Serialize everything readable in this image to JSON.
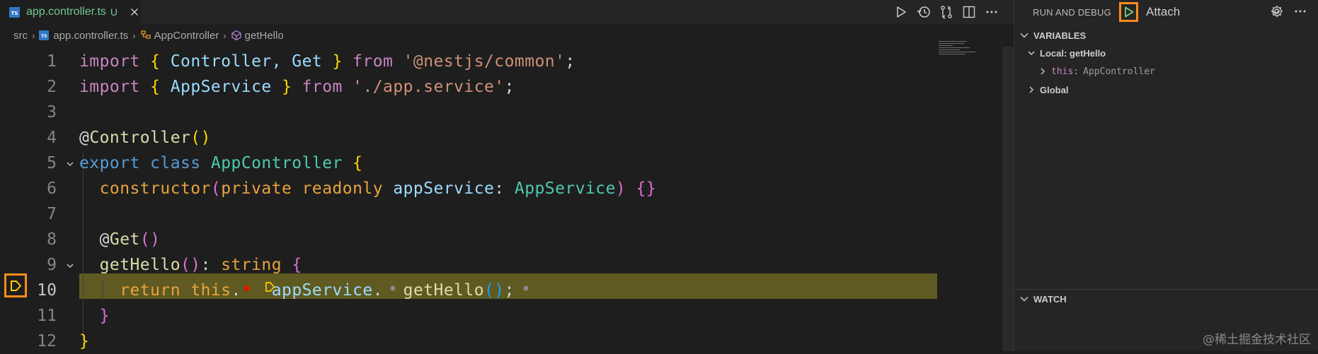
{
  "tab": {
    "icon_text": "TS",
    "filename": "app.controller.ts",
    "status": "U"
  },
  "editor_actions": [
    "run-icon",
    "timeline-icon",
    "compare-changes-icon",
    "split-editor-icon",
    "more-actions-icon"
  ],
  "breadcrumb": {
    "folder": "src",
    "file": "app.controller.ts",
    "class": "AppController",
    "method": "getHello"
  },
  "code": {
    "line_numbers": [
      "1",
      "2",
      "3",
      "4",
      "5",
      "6",
      "7",
      "8",
      "9",
      "10",
      "11",
      "12"
    ],
    "active_line": "10",
    "lines": [
      {
        "n": 1,
        "tokens": [
          [
            "import",
            "ctl"
          ],
          [
            " ",
            ""
          ],
          [
            "{",
            "brY"
          ],
          [
            " Controller, Get ",
            "vr"
          ],
          [
            "}",
            "brY"
          ],
          [
            " ",
            ""
          ],
          [
            "from",
            "ctl"
          ],
          [
            " ",
            ""
          ],
          [
            "'@nestjs/common'",
            "str"
          ],
          [
            ";",
            ""
          ]
        ]
      },
      {
        "n": 2,
        "tokens": [
          [
            "import",
            "ctl"
          ],
          [
            " ",
            ""
          ],
          [
            "{",
            "brY"
          ],
          [
            " AppService ",
            "vr"
          ],
          [
            "}",
            "brY"
          ],
          [
            " ",
            ""
          ],
          [
            "from",
            "ctl"
          ],
          [
            " ",
            ""
          ],
          [
            "'./app.service'",
            "str"
          ],
          [
            ";",
            ""
          ]
        ]
      },
      {
        "n": 3,
        "tokens": []
      },
      {
        "n": 4,
        "tokens": [
          [
            "@",
            ""
          ],
          [
            "Controller",
            "fn"
          ],
          [
            "()",
            "brY"
          ]
        ]
      },
      {
        "n": 5,
        "tokens": [
          [
            "export",
            "kw"
          ],
          [
            " ",
            ""
          ],
          [
            "class",
            "kw"
          ],
          [
            " ",
            ""
          ],
          [
            "AppController",
            "ty"
          ],
          [
            " ",
            ""
          ],
          [
            "{",
            "brY"
          ]
        ]
      },
      {
        "n": 6,
        "tokens": [
          [
            "  ",
            ""
          ],
          [
            "constructor",
            "kwo"
          ],
          [
            "(",
            "brP"
          ],
          [
            "private",
            "kwo"
          ],
          [
            " ",
            ""
          ],
          [
            "readonly",
            "kwo"
          ],
          [
            " ",
            ""
          ],
          [
            "appService",
            "vr"
          ],
          [
            ": ",
            ""
          ],
          [
            "AppService",
            "ty"
          ],
          [
            ")",
            "brP"
          ],
          [
            " ",
            ""
          ],
          [
            "{}",
            "brP"
          ]
        ]
      },
      {
        "n": 7,
        "tokens": []
      },
      {
        "n": 8,
        "tokens": [
          [
            "  @",
            ""
          ],
          [
            "Get",
            "fn"
          ],
          [
            "()",
            "brP"
          ]
        ]
      },
      {
        "n": 9,
        "tokens": [
          [
            "  ",
            ""
          ],
          [
            "getHello",
            "fn"
          ],
          [
            "()",
            "brP"
          ],
          [
            ": ",
            ""
          ],
          [
            "string",
            "kwo"
          ],
          [
            " ",
            ""
          ],
          [
            "{",
            "brP"
          ]
        ]
      },
      {
        "n": 10,
        "tokens": [
          [
            "    ",
            ""
          ],
          [
            "return",
            "kwo"
          ],
          [
            " ",
            ""
          ],
          [
            "this",
            "kwo"
          ],
          [
            ".",
            ""
          ],
          [
            "   ",
            ""
          ],
          [
            "appService",
            "vr"
          ],
          [
            ".",
            ""
          ],
          [
            "  ",
            ""
          ],
          [
            "getHello",
            "fn"
          ],
          [
            "()",
            "brB"
          ],
          [
            ";",
            ""
          ]
        ]
      },
      {
        "n": 11,
        "tokens": [
          [
            "  ",
            ""
          ],
          [
            "}",
            "brP"
          ]
        ]
      },
      {
        "n": 12,
        "tokens": [
          [
            "}",
            "brY"
          ]
        ]
      }
    ]
  },
  "debug_panel": {
    "title": "RUN AND DEBUG",
    "configuration": "Attach",
    "sections": {
      "variables": "VARIABLES",
      "watch": "WATCH"
    },
    "variables": {
      "local_scope": "Local: getHello",
      "local_var_name": "this:",
      "local_var_value": "AppController",
      "global_scope": "Global"
    }
  },
  "watermark": "@稀土掘金技术社区",
  "colors": {
    "accent_highlight": "#ff8c1a",
    "current_line": "#6b6522",
    "untracked_file": "#73c991",
    "editor_bg": "#1e1e1e",
    "sidebar_bg": "#252526"
  }
}
